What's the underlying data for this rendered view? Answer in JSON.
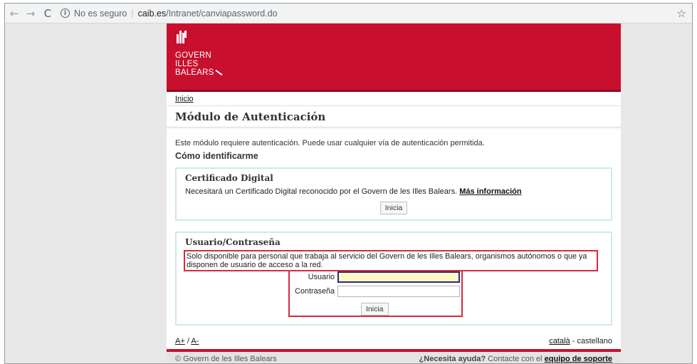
{
  "browser": {
    "back_icon": "←",
    "forward_icon": "→",
    "reload_icon": "C",
    "info_icon": "i",
    "security_label": "No es seguro",
    "separator": "|",
    "url_host": "caib.es",
    "url_path": "/Intranet/canviapassword.do",
    "star_icon": "☆"
  },
  "header": {
    "logo_lines": [
      "GOVERN",
      "ILLES",
      "BALEARS"
    ],
    "brand_color": "#c8102e"
  },
  "breadcrumb": {
    "home": "Inicio"
  },
  "page": {
    "title": "Módulo de Autenticación",
    "intro": "Este módulo requiere autenticación. Puede usar cualquier vía de autenticación permitida.",
    "subtitle": "Cómo identificarme"
  },
  "cert_panel": {
    "title": "Certificado Digital",
    "text": "Necesitará un Certificado Digital reconocido por el Govern de les Illes Balears.",
    "more_info": "Más información",
    "button": "Inicia"
  },
  "user_panel": {
    "title": "Usuario/Contraseña",
    "notice": "Solo disponible para personal que trabaja al servicio del Govern de les Illes Balears, organismos autónomos o que ya disponen de usuario de acceso a la red.",
    "user_label": "Usuario",
    "user_value": "",
    "pass_label": "Contraseña",
    "pass_value": "",
    "button": "Inicia"
  },
  "text_size": {
    "increase": "A+",
    "separator": "/",
    "decrease": "A-"
  },
  "languages": {
    "catala": "català",
    "dash": "-",
    "castellano": "castellano"
  },
  "footer": {
    "copyright": "© Govern de les Illes Balears",
    "help_question": "¿Necesita ayuda?",
    "help_text": "Contacte con el",
    "support_link": "equipo de soporte"
  }
}
